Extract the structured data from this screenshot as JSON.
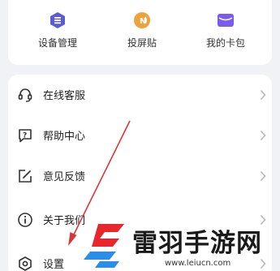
{
  "quick_actions": [
    {
      "label": "设备管理",
      "icon": "device-hexagon-icon",
      "color": "#5b5bd6"
    },
    {
      "label": "投屏贴",
      "icon": "nfc-cast-icon",
      "color": "#f0a23a"
    },
    {
      "label": "我的卡包",
      "icon": "card-wallet-icon",
      "color": "#7a5af0"
    }
  ],
  "menu": [
    {
      "label": "在线客服",
      "icon": "headset-icon"
    },
    {
      "label": "帮助中心",
      "icon": "help-question-icon"
    },
    {
      "label": "意见反馈",
      "icon": "edit-feedback-icon"
    },
    {
      "label": "关于我们",
      "icon": "info-icon"
    },
    {
      "label": "设置",
      "icon": "settings-hexagon-icon"
    }
  ],
  "watermark": {
    "title": "雷羽手游网",
    "url": "www.leiucn.com",
    "colors": {
      "red": "#e8262b",
      "blue": "#2a8ee8"
    }
  },
  "annotation": {
    "arrow_color": "#d9363a"
  }
}
